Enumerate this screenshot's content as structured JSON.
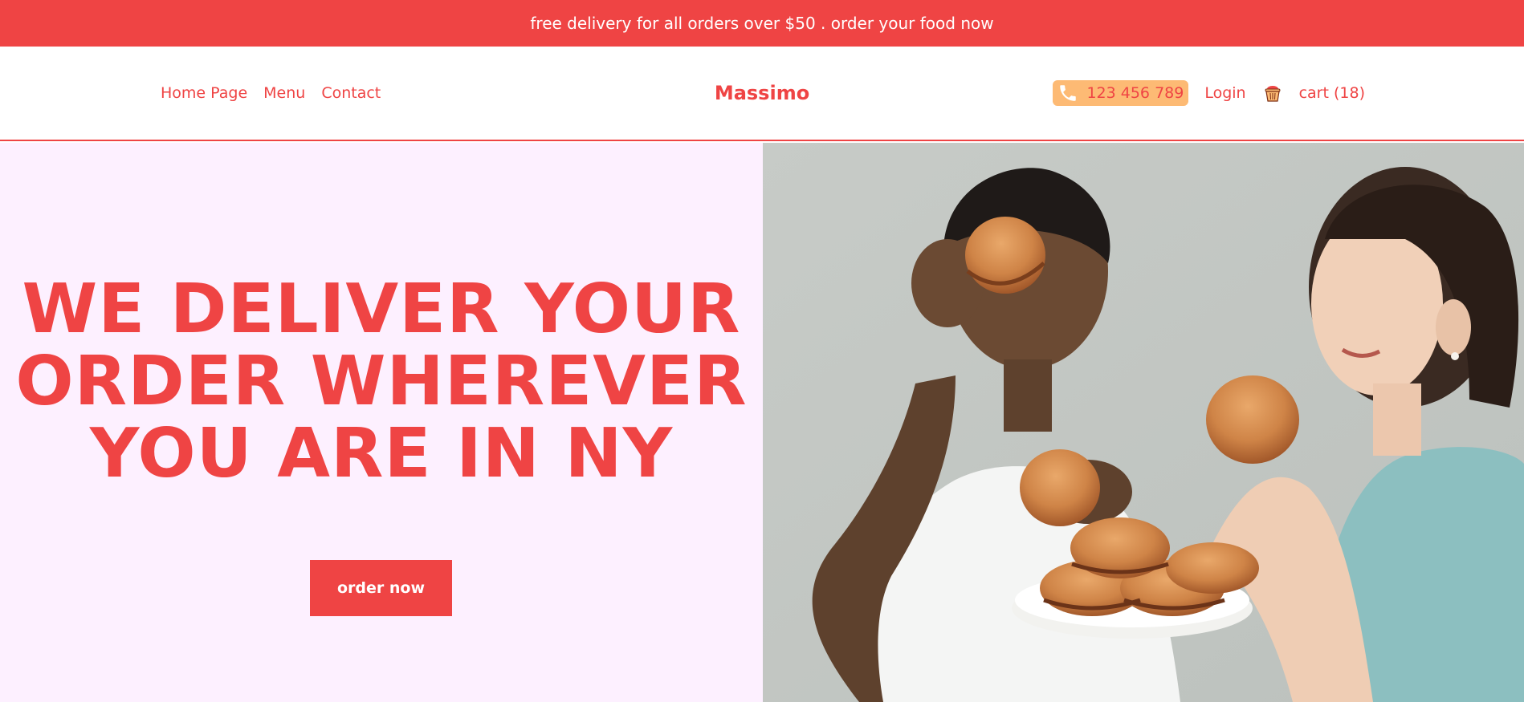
{
  "promo": {
    "text": "free delivery for all orders over $50 . order your food now"
  },
  "header": {
    "nav": [
      {
        "label": "Home Page"
      },
      {
        "label": "Menu"
      },
      {
        "label": "Contact"
      }
    ],
    "brand": "Massimo",
    "phone": {
      "number": "123 456 789",
      "icon": "phone-icon"
    },
    "login_label": "Login",
    "cart": {
      "label": "cart (18)",
      "icon": "basket-icon"
    }
  },
  "hero": {
    "title_lines": [
      "WE DELIVER YOUR",
      "ORDER WHEREVER",
      "YOU ARE IN NY"
    ],
    "cta_label": "order now",
    "image": "two women holding burgers and a plate of burgers"
  },
  "colors": {
    "accent": "#ef4444",
    "phone_badge": "#fdba74",
    "hero_background": "#fdf0ff"
  }
}
